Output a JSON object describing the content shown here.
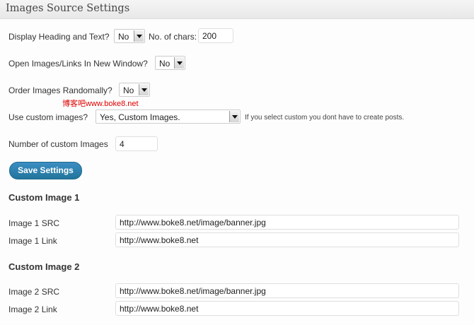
{
  "page": {
    "title": "Images Source Settings"
  },
  "display_heading": {
    "label": "Display Heading and Text?",
    "value": "No",
    "chars_label": "No. of chars:",
    "chars_value": "200"
  },
  "open_new_window": {
    "label": "Open Images/Links In New Window?",
    "value": "No"
  },
  "order_random": {
    "label": "Order Images Randomally?",
    "value": "No"
  },
  "watermark": "博客吧www.boke8.net",
  "custom_images": {
    "label": "Use custom images?",
    "value": "Yes, Custom Images.",
    "hint": "If you select custom you dont have to create posts."
  },
  "number_custom": {
    "label": "Number of custom Images",
    "value": "4"
  },
  "save_button": "Save Settings",
  "custom_image_1": {
    "heading": "Custom Image 1",
    "src_label": "Image 1 SRC",
    "src_value": "http://www.boke8.net/image/banner.jpg",
    "link_label": "Image 1 Link",
    "link_value": "http://www.boke8.net"
  },
  "custom_image_2": {
    "heading": "Custom Image 2",
    "src_label": "Image 2 SRC",
    "src_value": "http://www.boke8.net/image/banner.jpg",
    "link_label": "Image 2 Link",
    "link_value": "http://www.boke8.net"
  }
}
